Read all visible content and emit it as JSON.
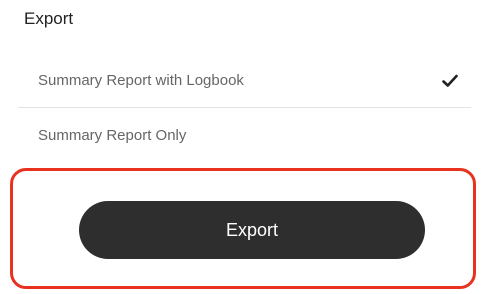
{
  "export_panel": {
    "title": "Export",
    "options": [
      {
        "label": "Summary Report with Logbook",
        "selected": true,
        "icon": "check-icon"
      },
      {
        "label": "Summary Report Only",
        "selected": false
      }
    ],
    "export_button_label": "Export",
    "highlight_color": "#e8321f",
    "button_color": "#2e2e2e"
  }
}
